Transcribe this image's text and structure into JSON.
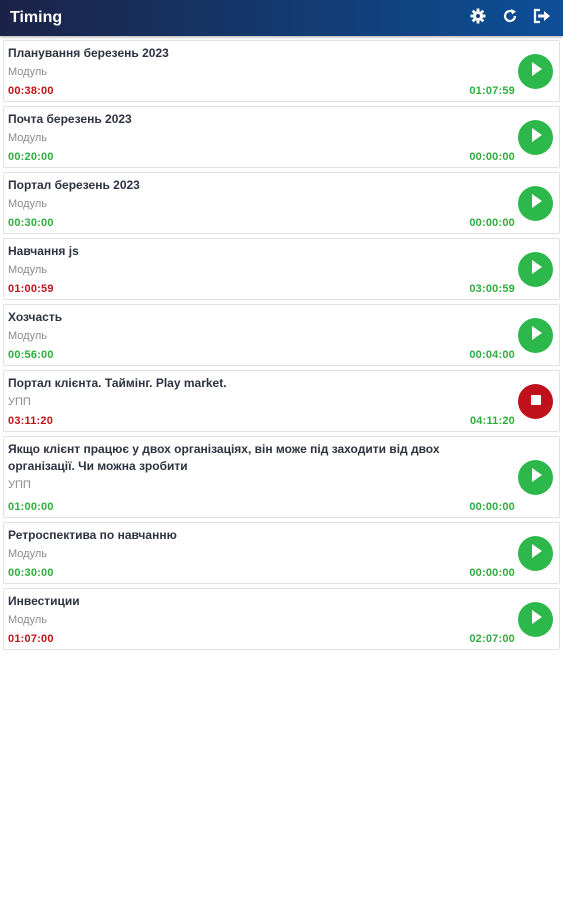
{
  "app": {
    "title": "Timing",
    "actions": [
      {
        "icon": "gear-icon"
      },
      {
        "icon": "refresh-icon"
      },
      {
        "icon": "logout-icon"
      }
    ]
  },
  "colors": {
    "appbar_start": "#1b2247",
    "appbar_end": "#0d4f98",
    "play": "#2db84b",
    "stop": "#c0101c",
    "time_red": "#c0141b",
    "time_green": "#2fae3e"
  },
  "tasks": [
    {
      "name": "Планування березень 2023",
      "type": "Модуль",
      "spent": "00:38:00",
      "spent_color": "red",
      "left": "01:07:59",
      "state": "play"
    },
    {
      "name": "Почта березень 2023",
      "type": "Модуль",
      "spent": "00:20:00",
      "spent_color": "green",
      "left": "00:00:00",
      "state": "play"
    },
    {
      "name": "Портал березень 2023",
      "type": "Модуль",
      "spent": "00:30:00",
      "spent_color": "green",
      "left": "00:00:00",
      "state": "play"
    },
    {
      "name": "Навчання js",
      "type": "Модуль",
      "spent": "01:00:59",
      "spent_color": "red",
      "left": "03:00:59",
      "state": "play"
    },
    {
      "name": "Хозчасть",
      "type": "Модуль",
      "spent": "00:56:00",
      "spent_color": "green",
      "left": "00:04:00",
      "state": "play"
    },
    {
      "name": "Портал клієнта. Таймінг. Play market.",
      "type": "УПП",
      "spent": "03:11:20",
      "spent_color": "red",
      "left": "04:11:20",
      "state": "stop"
    },
    {
      "name": "Якщо клієнт працює у двох організаціях, він може під заходити від двох організації. Чи можна зробити",
      "type": "УПП",
      "spent": "01:00:00",
      "spent_color": "green",
      "left": "00:00:00",
      "state": "play"
    },
    {
      "name": "Ретроспектива по навчанню",
      "type": "Модуль",
      "spent": "00:30:00",
      "spent_color": "green",
      "left": "00:00:00",
      "state": "play"
    },
    {
      "name": "Инвестиции",
      "type": "Модуль",
      "spent": "01:07:00",
      "spent_color": "red",
      "left": "02:07:00",
      "state": "play"
    }
  ]
}
